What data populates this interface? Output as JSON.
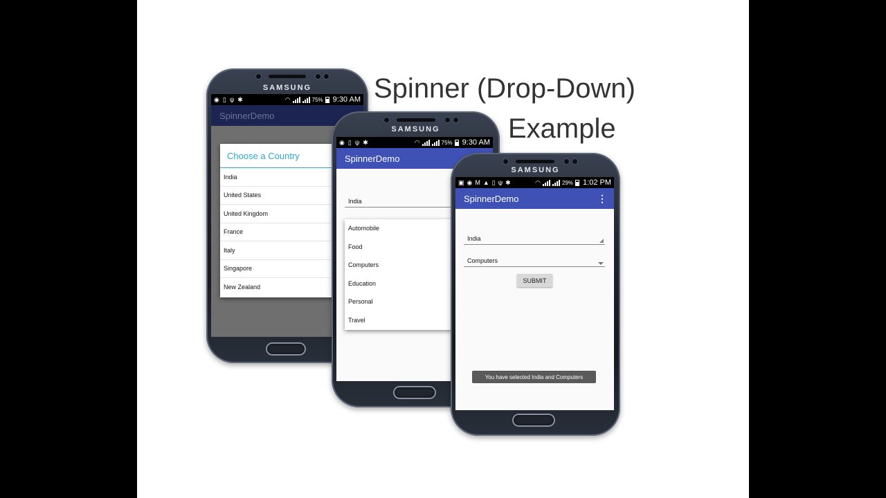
{
  "heading": {
    "line1": "Spinner (Drop-Down)",
    "line2": "Example"
  },
  "device": {
    "brand": "SAMSUNG"
  },
  "app": {
    "name": "SpinnerDemo"
  },
  "phone1": {
    "status": {
      "battery": "75%",
      "time": "9:30 AM"
    },
    "dialog": {
      "title": "Choose a Country",
      "items": [
        "India",
        "United States",
        "United Kingdom",
        "France",
        "Italy",
        "Singapore",
        "New Zealand"
      ]
    }
  },
  "phone2": {
    "status": {
      "battery": "75%",
      "time": "9:30 AM"
    },
    "country_spinner": {
      "value": "India"
    },
    "category_dropdown": {
      "items": [
        "Automobile",
        "Food",
        "Computers",
        "Education",
        "Personal",
        "Travel"
      ]
    }
  },
  "phone3": {
    "status": {
      "battery": "29%",
      "time": "1:02 PM"
    },
    "country_spinner": {
      "value": "India"
    },
    "category_spinner": {
      "value": "Computers"
    },
    "submit_label": "SUBMIT",
    "toast": "You have selected India and Computers"
  }
}
